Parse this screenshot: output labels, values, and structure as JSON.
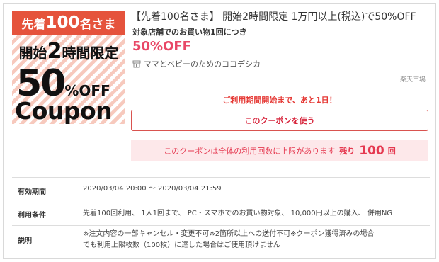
{
  "coupon_image": {
    "banner_prefix": "先着",
    "banner_number": "100",
    "banner_suffix": "名さま",
    "line2_a": "開始",
    "line2_b": "2",
    "line2_c": "時間限定",
    "big_number": "50",
    "percent": "%",
    "off": "OFF",
    "coupon_word": "Coupon"
  },
  "header": {
    "title": "【先着100名さま】 開始2時間限定 1万円以上(税込)で50%OFF",
    "subtitle": "対象店舗でのお買い物1回につき",
    "discount": "50%OFF",
    "shop_icon": "shop-icon",
    "shop_name": "ママとベビーのためのココデシカ",
    "market": "楽天市場"
  },
  "actions": {
    "notice": "ご利用期間開始まで、あと1日！",
    "use_button": "このクーポンを使う"
  },
  "limit": {
    "text": "このクーポンは全体の利用回数に上限があります",
    "remain_label": "残り",
    "remain_count": "100",
    "remain_unit": "回"
  },
  "details": [
    {
      "label": "有効期間",
      "value": "2020/03/04 20:00 〜 2020/03/04 21:59"
    },
    {
      "label": "利用条件",
      "value": "先着100回利用、 1人1回まで、 PC・スマホでのお買い物対象、 10,000円以上の購入、 併用NG"
    },
    {
      "label": "説明",
      "value": "※注文内容の一部キャンセル・変更不可※2箇所以上への送付不可※クーポン獲得済みの場合でも利用上限枚数（100枚）に達した場合はご使用頂けません"
    }
  ],
  "colors": {
    "accent_red": "#e53935",
    "discount_pink": "#e84766",
    "banner_orange": "#e5533c",
    "limit_bg": "#fde8ea"
  }
}
